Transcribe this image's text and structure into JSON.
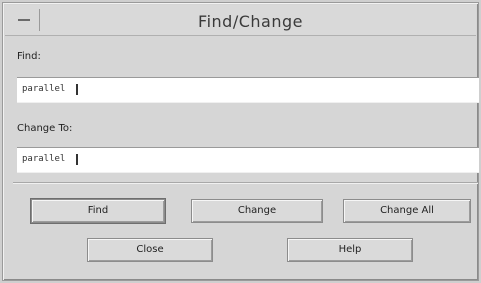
{
  "window": {
    "title": "Find/Change"
  },
  "find": {
    "label": "Find:",
    "value": "parallel"
  },
  "change": {
    "label": "Change To:",
    "value": "parallel"
  },
  "buttons": {
    "find": "Find",
    "change": "Change",
    "change_all": "Change All",
    "close": "Close",
    "help": "Help"
  },
  "icons": {
    "window_menu": "window-menu-icon"
  }
}
